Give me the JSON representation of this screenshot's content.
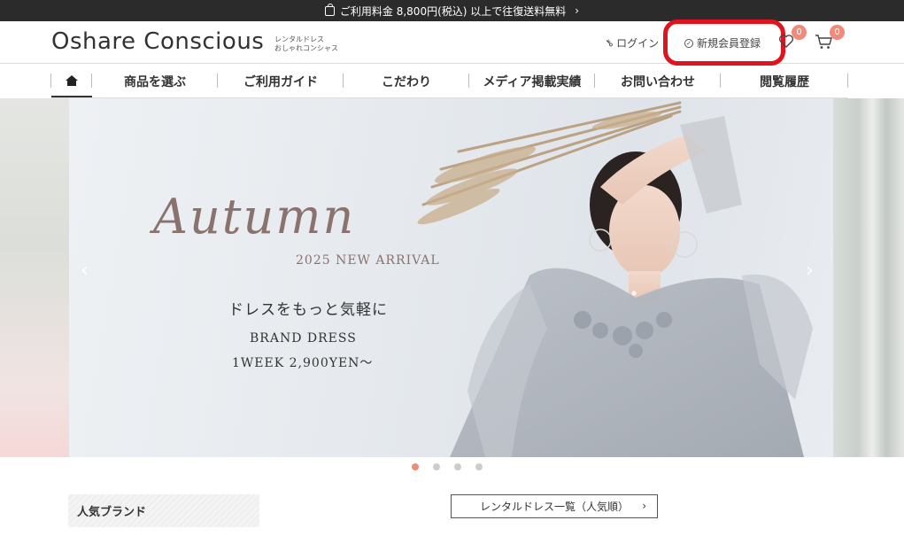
{
  "announcement": {
    "text": "ご利用料金 8,800円(税込) 以上で往復送料無料",
    "arrow": "›"
  },
  "header": {
    "logo": "Oshare Conscious",
    "logo_sub_1": "レンタルドレス",
    "logo_sub_2": "おしゃれコンシャス",
    "login_label": "ログイン",
    "register_label": "新規会員登録",
    "favorites_count": "0",
    "cart_count": "0"
  },
  "nav": {
    "items": [
      {
        "label": "商品を選ぶ"
      },
      {
        "label": "ご利用ガイド"
      },
      {
        "label": "こだわり"
      },
      {
        "label": "メディア掲載実績"
      },
      {
        "label": "お問い合わせ"
      },
      {
        "label": "閲覧履歴"
      }
    ]
  },
  "hero": {
    "script_title": "Autumn",
    "subtitle": "2025 NEW ARRIVAL",
    "tagline": "ドレスをもっと気軽に",
    "brand_line": "BRAND DRESS",
    "price_line": "1WEEK 2,900YEN〜",
    "prev_arrow": "‹",
    "next_arrow": "›",
    "slide_count": 4,
    "active_slide": 1
  },
  "sections": {
    "popular_brands": "人気ブランド",
    "rental_list_button": "レンタルドレス一覧（人気順）",
    "rental_list_arrow": "›"
  },
  "colors": {
    "accent": "#f08a7a",
    "highlight_ring": "#e0141e",
    "topbar_bg": "#2b2b2b"
  }
}
